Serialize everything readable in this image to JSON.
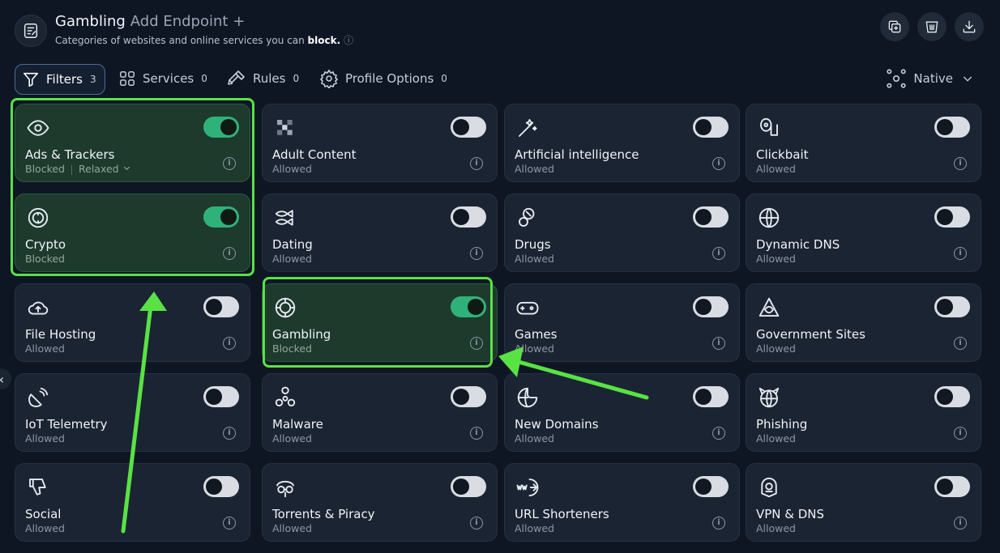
{
  "header": {
    "title": "Gambling",
    "add_endpoint": "Add Endpoint",
    "add_symbol": "+",
    "subtitle_prefix": "Categories of websites and online services you can",
    "subtitle_bold": "block.",
    "actions": [
      "duplicate-icon",
      "trash-icon",
      "download-icon"
    ]
  },
  "tabs": [
    {
      "label": "Filters",
      "count": "3",
      "icon": "filter-icon",
      "active": true
    },
    {
      "label": "Services",
      "count": "0",
      "icon": "grid-icon",
      "active": false
    },
    {
      "label": "Rules",
      "count": "0",
      "icon": "hammer-icon",
      "active": false
    },
    {
      "label": "Profile Options",
      "count": "0",
      "icon": "gear-icon",
      "active": false
    }
  ],
  "mode": {
    "label": "Native",
    "icon": "nodes-icon"
  },
  "categories": [
    {
      "name": "Ads & Trackers",
      "status": "Blocked",
      "level": "Relaxed",
      "enabled": true,
      "icon": "eye-icon"
    },
    {
      "name": "Adult Content",
      "status": "Allowed",
      "enabled": false,
      "icon": "pixelated-icon"
    },
    {
      "name": "Artificial intelligence",
      "status": "Allowed",
      "enabled": false,
      "icon": "magic-wand-icon"
    },
    {
      "name": "Clickbait",
      "status": "Allowed",
      "enabled": false,
      "icon": "toilet-paper-icon"
    },
    {
      "name": "Crypto",
      "status": "Blocked",
      "enabled": true,
      "icon": "coin-icon"
    },
    {
      "name": "Dating",
      "status": "Allowed",
      "enabled": false,
      "icon": "fish-icon"
    },
    {
      "name": "Drugs",
      "status": "Allowed",
      "enabled": false,
      "icon": "pills-icon"
    },
    {
      "name": "Dynamic DNS",
      "status": "Allowed",
      "enabled": false,
      "icon": "globe-icon"
    },
    {
      "name": "File Hosting",
      "status": "Allowed",
      "enabled": false,
      "icon": "cloud-upload-icon"
    },
    {
      "name": "Gambling",
      "status": "Blocked",
      "enabled": true,
      "icon": "poker-chip-icon"
    },
    {
      "name": "Games",
      "status": "Allowed",
      "enabled": false,
      "icon": "gamepad-icon"
    },
    {
      "name": "Government Sites",
      "status": "Allowed",
      "enabled": false,
      "icon": "pyramid-eye-icon"
    },
    {
      "name": "IoT Telemetry",
      "status": "Allowed",
      "enabled": false,
      "icon": "satellite-icon"
    },
    {
      "name": "Malware",
      "status": "Allowed",
      "enabled": false,
      "icon": "biohazard-icon"
    },
    {
      "name": "New Domains",
      "status": "Allowed",
      "enabled": false,
      "icon": "globe-sticker-icon"
    },
    {
      "name": "Phishing",
      "status": "Allowed",
      "enabled": false,
      "icon": "devil-globe-icon"
    },
    {
      "name": "Social",
      "status": "Allowed",
      "enabled": false,
      "icon": "thumbs-down-icon"
    },
    {
      "name": "Torrents & Piracy",
      "status": "Allowed",
      "enabled": false,
      "icon": "pirate-icon"
    },
    {
      "name": "URL Shorteners",
      "status": "Allowed",
      "enabled": false,
      "icon": "www-link-icon"
    },
    {
      "name": "VPN & DNS",
      "status": "Allowed",
      "enabled": false,
      "icon": "vpn-icon"
    }
  ],
  "colors": {
    "background": "#0e1624",
    "card": "#1b2432",
    "card_enabled": "#1d3a2d",
    "toggle_on": "#2fb27a",
    "highlight": "#59e244"
  }
}
